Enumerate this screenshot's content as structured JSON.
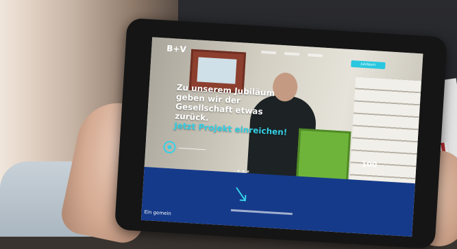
{
  "logo": "B+V",
  "cta_label": "Jubiläum",
  "headline": {
    "line1": "Zu unserem Jubiläum",
    "line2": "geben wir der",
    "line3": "Gesellschaft etwas",
    "line4": "zurück.",
    "highlight": "Jetzt Projekt einreichen!"
  },
  "badge": "100",
  "band_text": "Ein gemein",
  "icons": [
    "play-icon",
    "arrow-icon"
  ],
  "colors": {
    "accent": "#35d0e6",
    "band": "#163a8a",
    "cabinet": "#6fb43a"
  }
}
